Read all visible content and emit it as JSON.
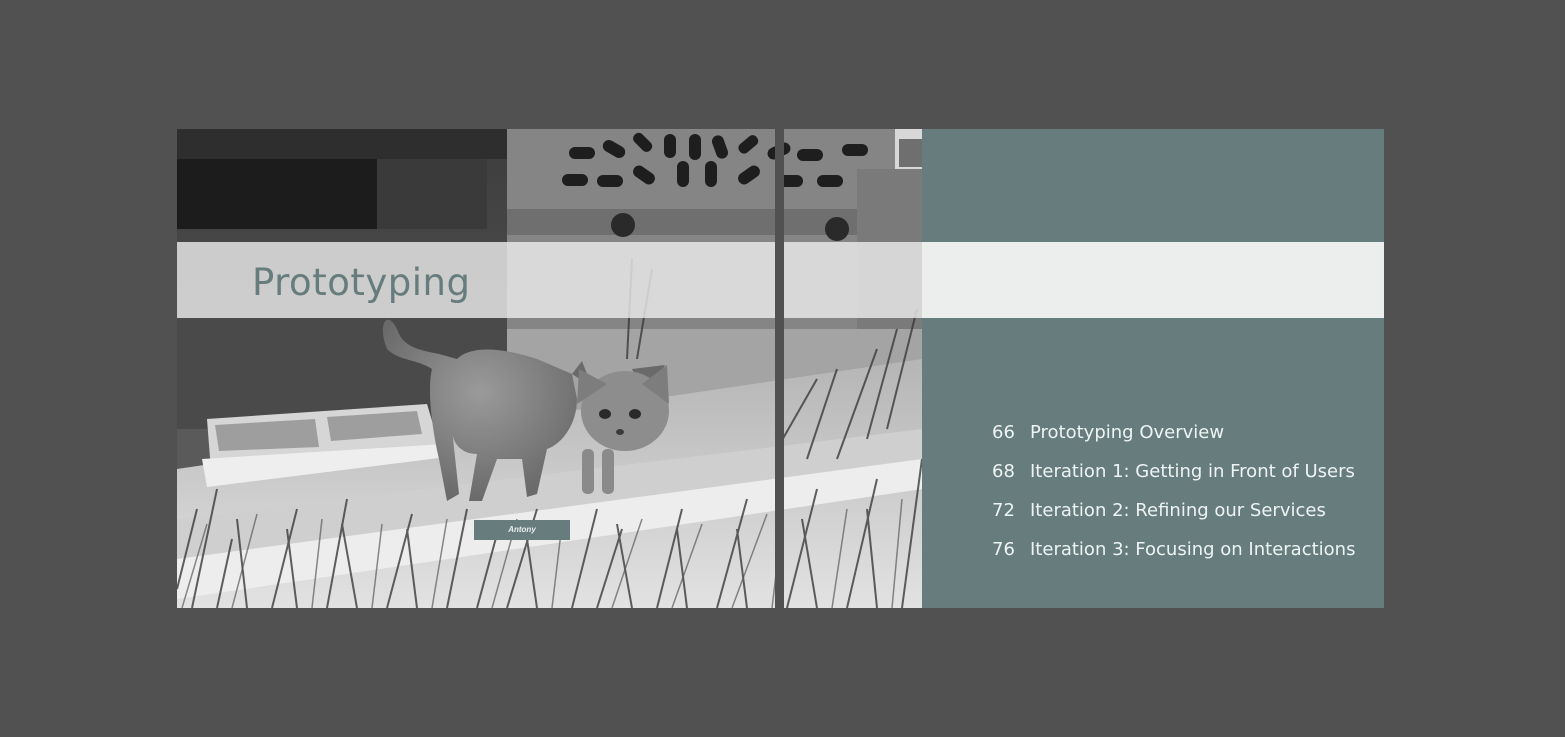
{
  "title": "Prototyping",
  "photo": {
    "caption": "Antony"
  },
  "toc": [
    {
      "page": "66",
      "label": "Prototyping Overview"
    },
    {
      "page": "68",
      "label": "Iteration 1: Getting in Front of Users"
    },
    {
      "page": "72",
      "label": "Iteration 2: Refining our Services"
    },
    {
      "page": "76",
      "label": "Iteration 3: Focusing on Interactions"
    }
  ],
  "colors": {
    "background": "#515151",
    "accent_teal": "#677d7d",
    "band": "#eceeed",
    "toc_text": "#eef3f3"
  }
}
